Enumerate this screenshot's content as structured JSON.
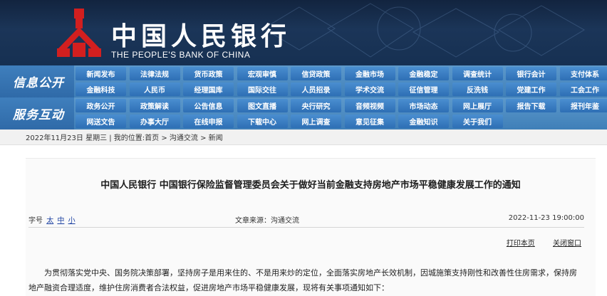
{
  "header": {
    "title_cn": "中国人民银行",
    "title_en": "THE PEOPLE'S BANK OF CHINA"
  },
  "nav": {
    "row1_head": "信息公开",
    "row2_head": "服务互动",
    "row1_top": [
      "新闻发布",
      "法律法规",
      "货币政策",
      "宏观审慎",
      "信贷政策",
      "金融市场",
      "金融稳定",
      "调查统计",
      "银行会计",
      "支付体系"
    ],
    "row1_bottom": [
      "金融科技",
      "人民币",
      "经理国库",
      "国际交往",
      "人员招录",
      "学术交流",
      "征信管理",
      "反洗钱",
      "党建工作",
      "工会工作"
    ],
    "row2_top": [
      "政务公开",
      "政策解读",
      "公告信息",
      "图文直播",
      "央行研究",
      "音频视频",
      "市场动态",
      "网上展厅",
      "报告下载",
      "报刊年鉴"
    ],
    "row2_bottom": [
      "网送文告",
      "办事大厅",
      "在线申报",
      "下载中心",
      "网上调查",
      "意见征集",
      "金融知识",
      "关于我们"
    ]
  },
  "breadcrumb": {
    "text": "2022年11月23日  星期三 | 我的位置:首页 > 沟通交流 > 新闻"
  },
  "article": {
    "title": "中国人民银行 中国银行保险监督管理委员会关于做好当前金融支持房地产市场平稳健康发展工作的通知",
    "font_size_label": "字号",
    "font_sizes": [
      "太",
      "中",
      "小"
    ],
    "source": "文章来源：沟通交流",
    "datetime": "2022-11-23 19:00:00",
    "print_label": "打印本页",
    "close_label": "关闭窗口",
    "paragraph": "为贯彻落实党中央、国务院决策部署，坚持房子是用来住的、不是用来炒的定位，全面落实房地产长效机制，因城施策支持刚性和改善性住房需求，保持房地产融资合理适度，维护住房消费者合法权益，促进房地产市场平稳健康发展，现将有关事项通知如下："
  },
  "colors": {
    "banner": "#1b3558",
    "nav": "#3f7fb8",
    "logo_red": "#d21f1f"
  }
}
